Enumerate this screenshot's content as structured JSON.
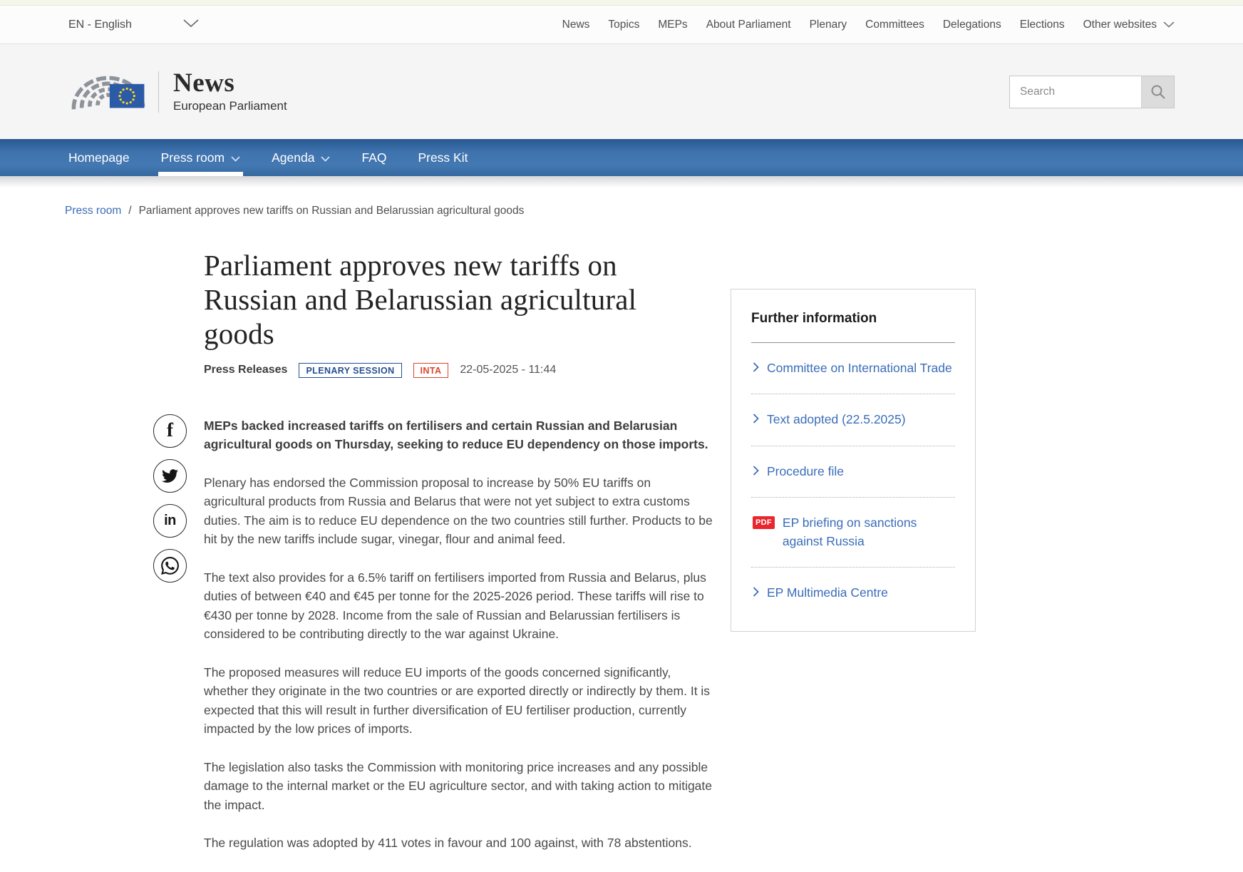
{
  "top_nav": {
    "language": "EN - English",
    "items": [
      "News",
      "Topics",
      "MEPs",
      "About Parliament",
      "Plenary",
      "Committees",
      "Delegations",
      "Elections"
    ],
    "other_websites": "Other websites"
  },
  "header": {
    "site_title": "News",
    "site_subtitle": "European Parliament",
    "search_placeholder": "Search"
  },
  "main_nav": {
    "items": [
      {
        "label": "Homepage"
      },
      {
        "label": "Press room"
      },
      {
        "label": "Agenda"
      },
      {
        "label": "FAQ"
      },
      {
        "label": "Press Kit"
      }
    ]
  },
  "breadcrumb": {
    "link": "Press room",
    "separator": "/",
    "current": "Parliament approves new tariffs on Russian and Belarussian agricultural goods"
  },
  "article": {
    "title": "Parliament approves new tariffs on Russian and Belarussian agricultural goods",
    "category": "Press Releases",
    "badge_session": "PLENARY SESSION",
    "badge_committee": "INTA",
    "date": "22-05-2025 - 11:44",
    "intro": "MEPs backed increased tariffs on fertilisers and certain Russian and Belarusian agricultural goods on Thursday, seeking to reduce EU dependency on those imports.",
    "paragraphs": [
      "Plenary has endorsed the Commission proposal to increase by 50% EU tariffs on agricultural products from Russia and Belarus that were not yet subject to extra customs duties. The aim is to reduce EU dependence on the two countries still further. Products to be hit by the new tariffs include sugar, vinegar, flour and animal feed.",
      "The text also provides for a 6.5% tariff on fertilisers imported from Russia and Belarus, plus duties of between €40 and €45 per tonne for the 2025-2026 period. These tariffs will rise to €430 per tonne by 2028. Income from the sale of Russian and Belarussian fertilisers is considered to be contributing directly to the war against Ukraine.",
      "The proposed measures will reduce EU imports of the goods concerned significantly, whether they originate in the two countries or are exported directly or indirectly by them. It is expected that this will result in further diversification of EU fertiliser production, currently impacted by the low prices of imports.",
      "The legislation also tasks the Commission with monitoring price increases and any possible damage to the internal market or the EU agriculture sector, and with taking action to mitigate the impact.",
      "The regulation was adopted by 411 votes in favour and 100 against, with 78 abstentions."
    ]
  },
  "sidebar": {
    "title": "Further information",
    "pdf_badge_label": "PDF",
    "links": [
      {
        "label": "Committee on International Trade"
      },
      {
        "label": "Text adopted (22.5.2025)"
      },
      {
        "label": "Procedure file"
      },
      {
        "label": "EP briefing on sanctions against Russia"
      },
      {
        "label": "EP Multimedia Centre"
      }
    ]
  },
  "colors": {
    "nav_blue": "#3f73ad",
    "link_blue": "#3a6db8",
    "badge_blue": "#24508f",
    "badge_red": "#d9472f",
    "pdf_red": "#e9252e"
  }
}
